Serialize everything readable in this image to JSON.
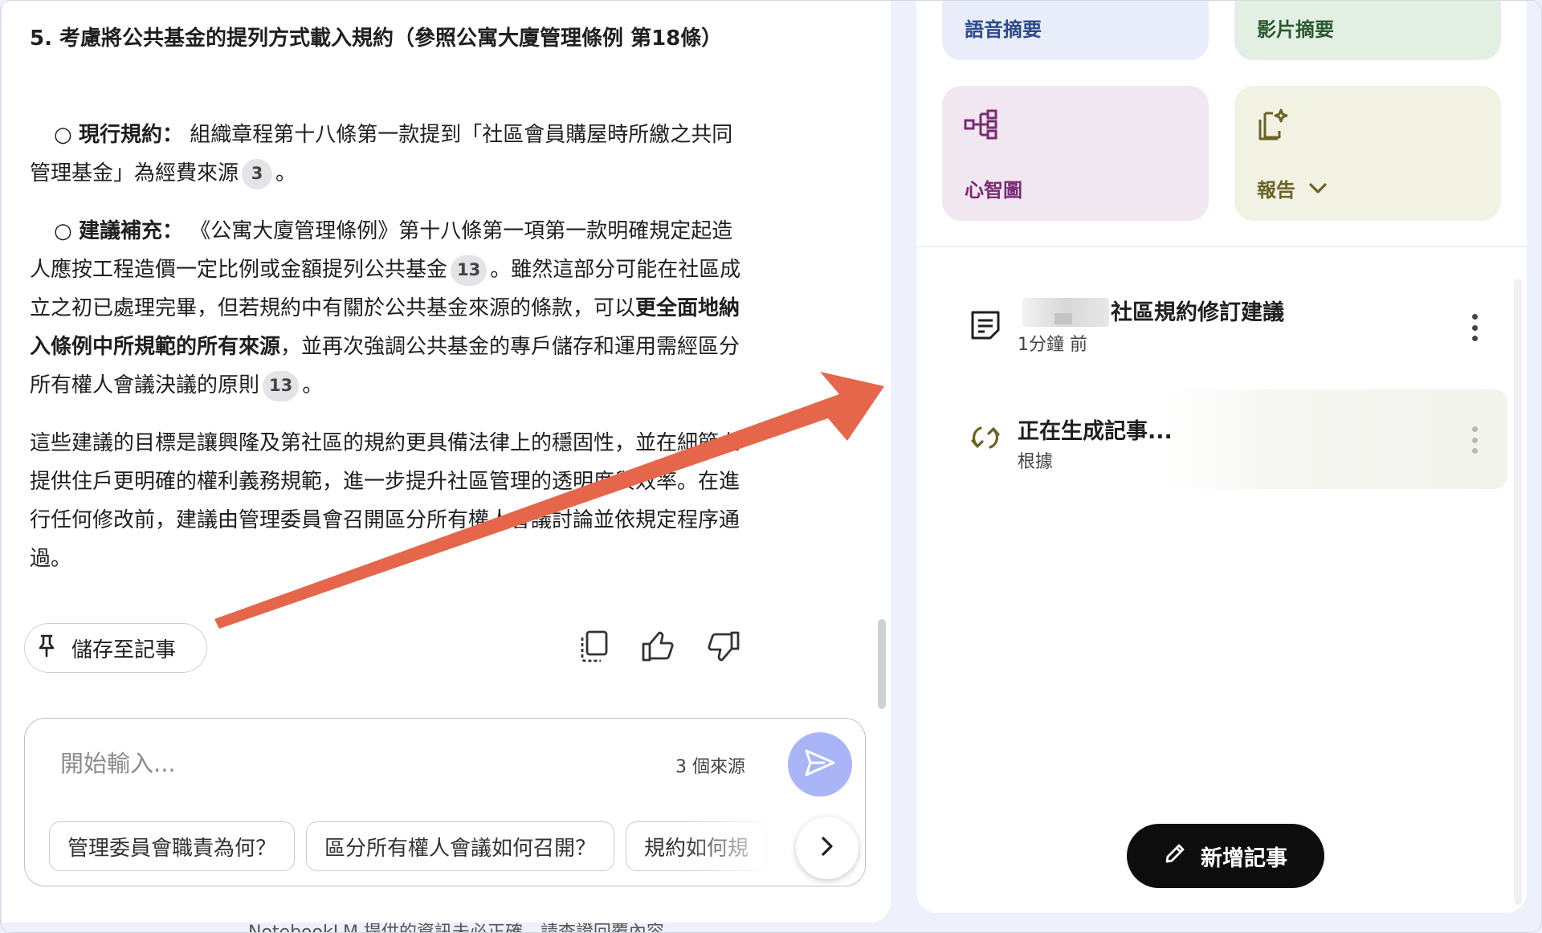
{
  "chat": {
    "heading5": "5. 考慮將公共基金的提列方式載入規約（參照公寓大廈管理條例 第18條）",
    "current": {
      "bullet": "○ ",
      "label": "現行規約：",
      "text": " 組織章程第十八條第一款提到「社區會員購屋時所繳之共同管理基金」為經費來源",
      "cite": "3",
      "tail": "。"
    },
    "suggest": {
      "bullet": "○ ",
      "label": "建議補充：",
      "text1": " 《公寓大廈管理條例》第十八條第一項第一款明確規定起造人應按工程造價一定比例或金額提列公共基金",
      "cite1": "13",
      "text2": "。雖然這部分可能在社區成立之初已處理完畢，但若規約中有關於公共基金來源的條款，可以",
      "bold": "更全面地納入條例中所規範的所有來源",
      "text3": "，並再次強調公共基金的專戶儲存和運用需經區分所有權人會議決議的原則",
      "cite2": "13",
      "tail": "。"
    },
    "goal": "這些建議的目標是讓興隆及第社區的規約更具備法律上的穩固性，並在細節上提供住戶更明確的權利義務規範，進一步提升社區管理的透明度與效率。在進行任何修改前，建議由管理委員會召開區分所有權人會議討論並依規定程序通過。",
    "save_note": "儲存至記事",
    "icons": {
      "pin": "pin-icon",
      "copy": "copy-icon",
      "like": "thumb-up-icon",
      "dislike": "thumb-down-icon"
    },
    "composer": {
      "placeholder": "開始輸入...",
      "source_count": "3 個來源",
      "chips": [
        "管理委員會職責為何？",
        "區分所有權人會議如何召開？",
        "規約如何規"
      ]
    },
    "disclaimer": "NotebookLM 提供的資訊未必正確，請查證回覆內容。"
  },
  "studio": {
    "tiles": {
      "audio": "語音摘要",
      "video": "影片摘要",
      "mindmap": "心智圖",
      "report": "報告"
    },
    "notes": [
      {
        "title": "社區規約修訂建議",
        "subtitle": "1分鐘 前"
      },
      {
        "title": "正在生成記事...",
        "subtitle": "根據"
      }
    ],
    "add_note": "新增記事"
  },
  "colors": {
    "arrow": "#e5664a",
    "send_button": "#a9b5f7",
    "mindmap_accent": "#7b2a76",
    "report_accent": "#6b6324",
    "add_note_bg": "#0d0d0d"
  }
}
